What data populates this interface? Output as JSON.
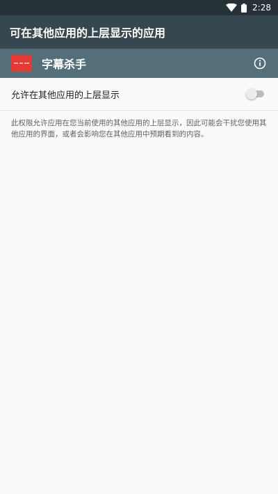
{
  "status_bar": {
    "time": "2:28",
    "icons": [
      "wifi-icon",
      "battery-icon"
    ]
  },
  "app_bar": {
    "title": "可在其他应用的上层显示的应用"
  },
  "app_header": {
    "app_name": "字幕杀手",
    "logo_icon": "app-logo-icon",
    "info_icon": "info-icon"
  },
  "setting": {
    "label": "允许在其他应用的上层显示",
    "enabled": false
  },
  "description": "此权限允许应用在您当前使用的其他应用的上层显示，因此可能会干扰您使用其他应用的界面，或者会影响您在其他应用中预期看到的内容。",
  "colors": {
    "status_bar": "#263238",
    "app_bar": "#37474f",
    "app_header": "#546e7a",
    "logo": "#e53935"
  }
}
